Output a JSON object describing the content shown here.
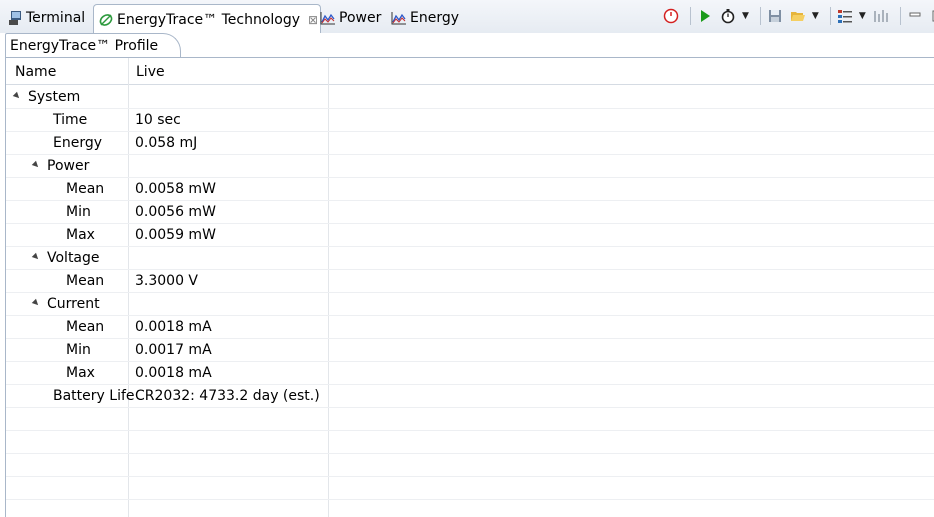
{
  "tabs": [
    {
      "label": "Terminal",
      "icon": "terminal-icon"
    },
    {
      "label": "EnergyTrace™ Technology",
      "icon": "energytrace-icon",
      "active": true
    },
    {
      "label": "Power",
      "icon": "chart-icon"
    },
    {
      "label": "Energy",
      "icon": "chart-icon"
    }
  ],
  "toolbar": {
    "icons": [
      "stop-icon",
      "play-icon",
      "stopwatch-icon",
      "save-icon",
      "open-folder-icon",
      "view-menu-icon",
      "bars-icon",
      "minimize-icon"
    ]
  },
  "subtab": {
    "label": "EnergyTrace™ Profile"
  },
  "table": {
    "columns": [
      "Name",
      "Live"
    ],
    "rows": [
      {
        "name": "System",
        "value": "",
        "level": 0,
        "expandable": true
      },
      {
        "name": "Time",
        "value": "10 sec",
        "level": 1,
        "expandable": false
      },
      {
        "name": "Energy",
        "value": "0.058 mJ",
        "level": 1,
        "expandable": false
      },
      {
        "name": "Power",
        "value": "",
        "level": 1,
        "expandable": true
      },
      {
        "name": "Mean",
        "value": "0.0058 mW",
        "level": 2,
        "expandable": false
      },
      {
        "name": "Min",
        "value": "0.0056 mW",
        "level": 2,
        "expandable": false
      },
      {
        "name": "Max",
        "value": "0.0059 mW",
        "level": 2,
        "expandable": false
      },
      {
        "name": "Voltage",
        "value": "",
        "level": 1,
        "expandable": true
      },
      {
        "name": "Mean",
        "value": "3.3000 V",
        "level": 2,
        "expandable": false
      },
      {
        "name": "Current",
        "value": "",
        "level": 1,
        "expandable": true
      },
      {
        "name": "Mean",
        "value": "0.0018 mA",
        "level": 2,
        "expandable": false
      },
      {
        "name": "Min",
        "value": "0.0017 mA",
        "level": 2,
        "expandable": false
      },
      {
        "name": "Max",
        "value": "0.0018 mA",
        "level": 2,
        "expandable": false
      },
      {
        "name": "Battery Life",
        "value": "CR2032: 4733.2 day (est.)",
        "level": 1,
        "expandable": false
      }
    ]
  },
  "colors": {
    "accent": "#a9b7c9",
    "stop": "#d42020",
    "play": "#1a9a1a"
  }
}
